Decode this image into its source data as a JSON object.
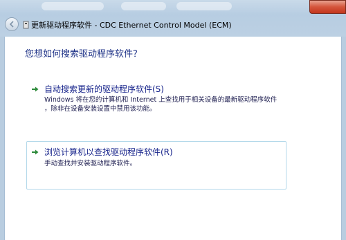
{
  "window": {
    "title": "更新驱动程序软件 - CDC Ethernet Control Model (ECM)"
  },
  "heading": "您想如何搜索驱动程序软件？",
  "options": [
    {
      "title": "自动搜索更新的驱动程序软件(S)",
      "desc_line1": "Windows 将在您的计算机和 Internet 上查找用于相关设备的最新驱动程序软件",
      "desc_line2": "，除非在设备安装设置中禁用该功能。"
    },
    {
      "title": "浏览计算机以查找驱动程序软件(R)",
      "desc_line1": "手动查找并安装驱动程序软件。"
    }
  ],
  "colors": {
    "heading": "#1e3287",
    "option_title": "#15228a",
    "arrow": "#2d8a3a",
    "close": "#c2361d"
  },
  "icons": {
    "back": "back-arrow-icon",
    "title": "device-icon",
    "option_arrow": "green-arrow-icon",
    "close": "close-icon"
  }
}
